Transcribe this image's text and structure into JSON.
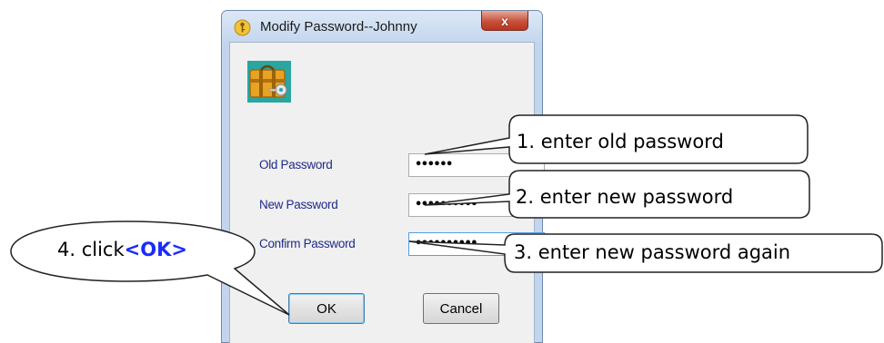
{
  "window": {
    "title": "Modify Password--Johnny",
    "close_glyph": "x",
    "title_icon": "key-icon",
    "app_icon": "suitcase-key-icon"
  },
  "form": {
    "fields": [
      {
        "label": "Old Password",
        "masked_value": "••••••"
      },
      {
        "label": "New Password",
        "masked_value": "••••••••••"
      },
      {
        "label": "Confirm Password",
        "masked_value": "••••••••••"
      }
    ]
  },
  "buttons": {
    "ok_label": "OK",
    "cancel_label": "Cancel"
  },
  "annotations": {
    "step1": "1. enter old password",
    "step2": "2. enter new password",
    "step3": "3. enter new password again",
    "step4_prefix": "4. click",
    "step4_target": "<OK>"
  },
  "colors": {
    "label_text": "#1f2a8a",
    "accent_blue": "#1a2bff",
    "close_red": "#c7513b"
  }
}
